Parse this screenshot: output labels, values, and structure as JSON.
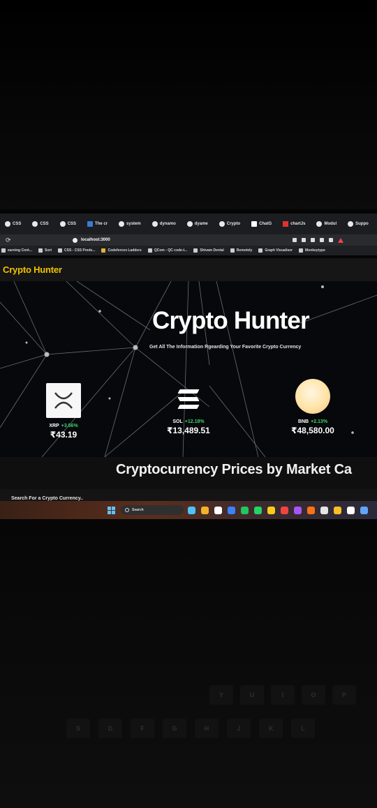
{
  "browser": {
    "tabs": [
      {
        "label": "CSS",
        "icon": "github-icon"
      },
      {
        "label": "CSS",
        "icon": "github-icon"
      },
      {
        "label": "CSS",
        "icon": "github-icon"
      },
      {
        "label": "The cr",
        "icon": "doc-icon"
      },
      {
        "label": "system",
        "icon": "github-icon"
      },
      {
        "label": "dynamo",
        "icon": "github-icon"
      },
      {
        "label": "dyame",
        "icon": "github-icon"
      },
      {
        "label": "Crypto",
        "icon": "github-icon"
      },
      {
        "label": "ChatG",
        "icon": "chat-icon"
      },
      {
        "label": "chartJs",
        "icon": "flag-icon"
      },
      {
        "label": "Modul",
        "icon": "github-icon"
      },
      {
        "label": "Suppo",
        "icon": "github-icon"
      }
    ],
    "url": "localhost:3000",
    "bookmarks": [
      {
        "label": "earning Cont...",
        "icon": "bookmark-icon"
      },
      {
        "label": "Sort",
        "icon": "bookmark-icon"
      },
      {
        "label": "CSS - CSS Prede...",
        "icon": "github-icon"
      },
      {
        "label": "Codeforces Ladders",
        "icon": "codeforces-icon"
      },
      {
        "label": "QCom - QC code-t...",
        "icon": "bookmark-icon"
      },
      {
        "label": "Shivam Dental",
        "icon": "bookmark-icon"
      },
      {
        "label": "Remotely",
        "icon": "bookmark-icon"
      },
      {
        "label": "Graph Visualiser",
        "icon": "github-icon"
      },
      {
        "label": "Monkeytype",
        "icon": "bookmark-icon"
      }
    ]
  },
  "site": {
    "brand": "Crypto Hunter",
    "hero_title": "Crypto Hunter",
    "hero_subtitle": "Get All The Information Rgearding Your Favorite Crypto Currency",
    "coins": [
      {
        "symbol": "XRP",
        "change": "+3.56%",
        "price": "₹43.19",
        "icon": "xrp-logo-icon"
      },
      {
        "symbol": "SOL",
        "change": "+12.18%",
        "price": "₹13,489.51",
        "icon": "solana-logo-icon"
      },
      {
        "symbol": "BNB",
        "change": "+2.13%",
        "price": "₹48,580.00",
        "icon": "bnb-logo-icon"
      }
    ],
    "section_title": "Cryptocurrency Prices by Market Ca",
    "search_placeholder": "Search For a Crypto Currency.."
  },
  "taskbar": {
    "search_label": "Search",
    "app_colors": [
      "#4cc2ff",
      "#f0b429",
      "#ffffff",
      "#3b82f6",
      "#22c55e",
      "#25d366",
      "#facc15",
      "#ef4444",
      "#a855f7",
      "#f97316",
      "#e5e5e5",
      "#fbbf24",
      "#ffffff",
      "#60a5fa"
    ]
  },
  "keyboard": {
    "row1": [
      "Y",
      "U",
      "I",
      "O",
      "P"
    ],
    "row2": [
      "S",
      "D",
      "F",
      "G",
      "H",
      "J",
      "K",
      "L"
    ]
  },
  "colors": {
    "brand": "#f2c200",
    "positive": "#3cd46b",
    "background": "#07080b"
  }
}
